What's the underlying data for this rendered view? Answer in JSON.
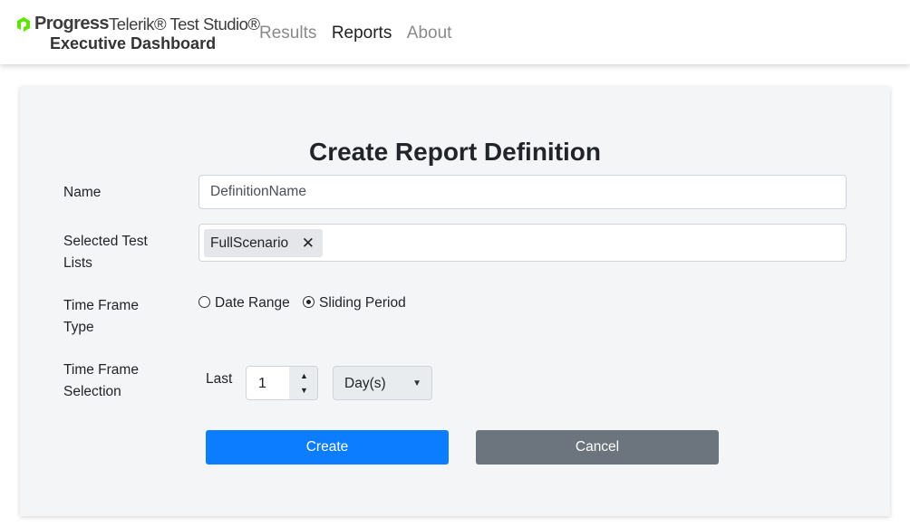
{
  "brand": {
    "company": "Progress",
    "product": "Telerik® Test Studio®",
    "subtitle": "Executive Dashboard",
    "logo_color": "#5ce500"
  },
  "nav": {
    "items": [
      {
        "label": "Results",
        "active": false
      },
      {
        "label": "Reports",
        "active": true
      },
      {
        "label": "About",
        "active": false
      }
    ]
  },
  "form": {
    "title": "Create Report Definition",
    "name": {
      "label": "Name",
      "value": "DefinitionName"
    },
    "test_lists": {
      "label": "Selected Test Lists",
      "selected": [
        "FullScenario"
      ],
      "remove_icon": "close-icon"
    },
    "time_frame_type": {
      "label": "Time Frame Type",
      "options": [
        {
          "label": "Date Range",
          "checked": false
        },
        {
          "label": "Sliding Period",
          "checked": true
        }
      ]
    },
    "time_frame_selection": {
      "label": "Time Frame Selection",
      "prefix": "Last",
      "amount": "1",
      "unit": "Day(s)"
    },
    "buttons": {
      "create": "Create",
      "cancel": "Cancel"
    }
  },
  "colors": {
    "primary": "#0d7dff",
    "secondary": "#6c757d",
    "card_bg": "#f4f5f7"
  }
}
